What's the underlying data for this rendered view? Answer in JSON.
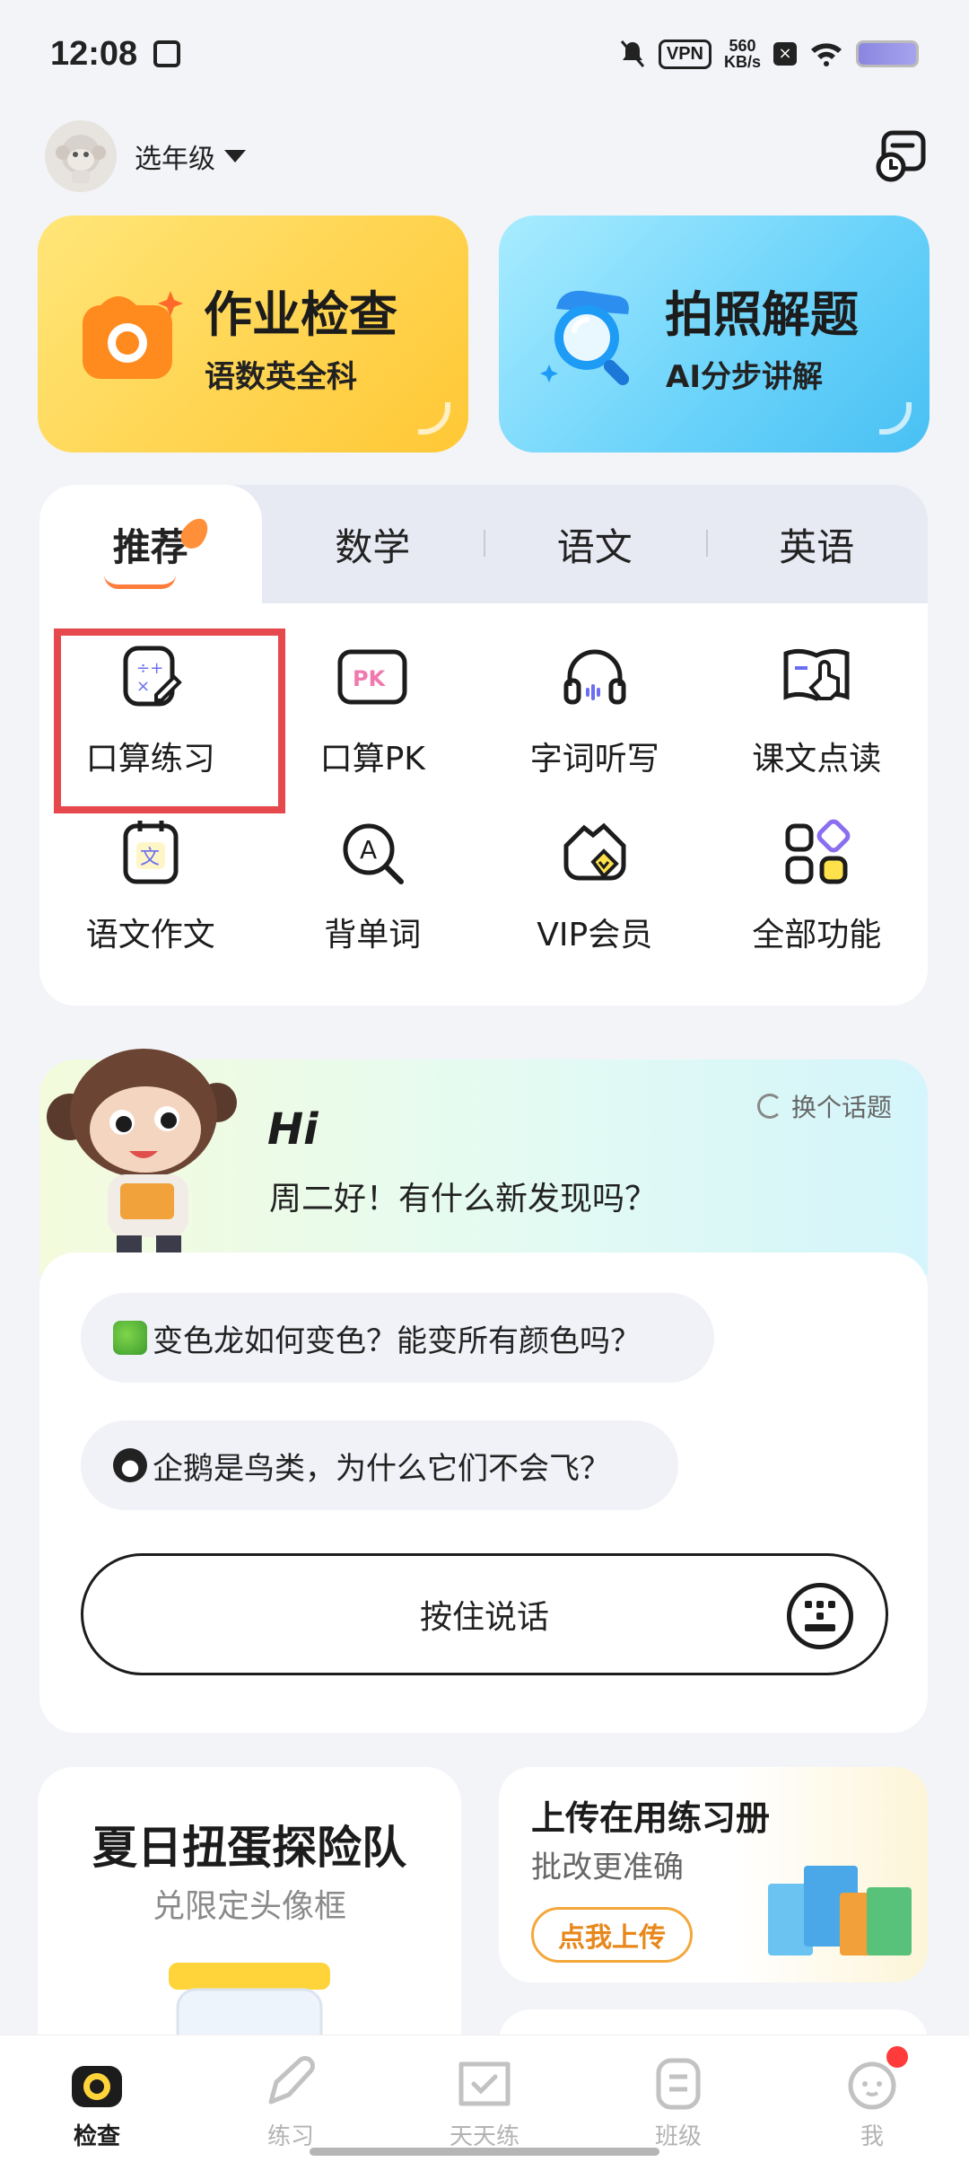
{
  "status_bar": {
    "time": "12:08",
    "vpn": "VPN",
    "speed_value": "560",
    "speed_unit": "KB/s"
  },
  "header": {
    "grade_label": "选年级"
  },
  "top_cards": [
    {
      "title": "作业检查",
      "subtitle": "语数英全科"
    },
    {
      "title": "拍照解题",
      "subtitle": "AI分步讲解"
    }
  ],
  "tabs": [
    "推荐",
    "数学",
    "语文",
    "英语"
  ],
  "features": [
    {
      "label": "口算练习",
      "icon": "mental-math-icon"
    },
    {
      "label": "口算PK",
      "icon": "pk-icon"
    },
    {
      "label": "字词听写",
      "icon": "headphones-icon"
    },
    {
      "label": "课文点读",
      "icon": "book-point-icon"
    },
    {
      "label": "语文作文",
      "icon": "composition-icon"
    },
    {
      "label": "背单词",
      "icon": "word-search-icon"
    },
    {
      "label": "VIP会员",
      "icon": "vip-basket-icon"
    },
    {
      "label": "全部功能",
      "icon": "all-features-icon"
    }
  ],
  "pk_text": "PK",
  "wen_text": "文",
  "a_text": "A",
  "chat": {
    "hi": "Hi",
    "greeting": "周二好！有什么新发现吗？",
    "change_topic": "换个话题",
    "suggestions": [
      "变色龙如何变色？能变所有颜色吗？",
      "企鹅是鸟类，为什么它们不会飞？"
    ],
    "talk_button": "按住说话"
  },
  "promos": {
    "event_title": "夏日扭蛋探险队",
    "event_subtitle": "兑限定头像框",
    "upload_title": "上传在用练习册",
    "upload_subtitle": "批改更准确",
    "upload_button": "点我上传"
  },
  "nav": [
    "检查",
    "练习",
    "天天练",
    "班级",
    "我"
  ],
  "colors": {
    "accent_orange": "#ff8f38",
    "highlight_red": "#e5484d",
    "yellow": "#ffd34e",
    "blue": "#48c0f3"
  }
}
